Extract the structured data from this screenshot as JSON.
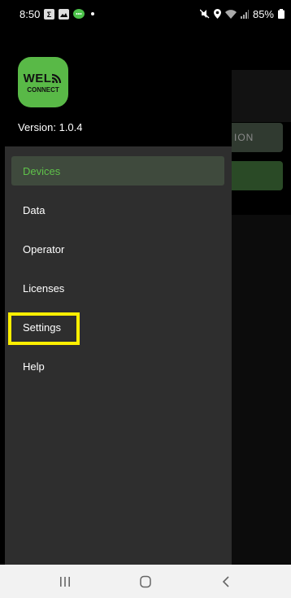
{
  "status_bar": {
    "time": "8:50",
    "battery": "85%",
    "left_icons": [
      "email-app-icon",
      "gallery-icon",
      "chat-icon"
    ],
    "right_icons": [
      "mute-icon",
      "location-icon",
      "wifi-icon",
      "signal-icon",
      "battery-icon"
    ]
  },
  "drawer": {
    "logo_line1": "WEL",
    "logo_line2": "CONNECT",
    "version": "Version: 1.0.4",
    "items": [
      {
        "label": "Devices",
        "active": true
      },
      {
        "label": "Data"
      },
      {
        "label": "Operator"
      },
      {
        "label": "Licenses"
      },
      {
        "label": "Settings",
        "highlighted": true
      },
      {
        "label": "Help"
      }
    ]
  },
  "background": {
    "button1_label": "ION"
  },
  "colors": {
    "accent": "#5fc24a",
    "logo": "#59b947",
    "drawer_body": "#2e2e2e",
    "highlight": "#ffef00",
    "nav_bar": "#f2f2f2"
  }
}
